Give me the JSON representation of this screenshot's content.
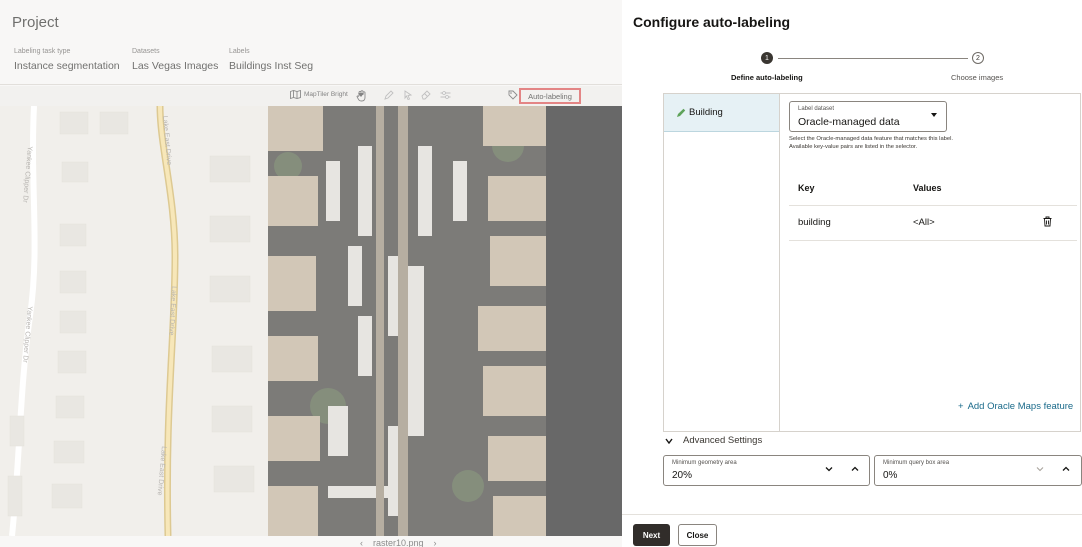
{
  "project": {
    "title": "Project",
    "info": [
      {
        "label": "Labeling task type",
        "value": "Instance segmentation"
      },
      {
        "label": "Datasets",
        "value": "Las Vegas Images"
      },
      {
        "label": "Labels",
        "value": "Buildings Inst Seg"
      }
    ],
    "toolbar": {
      "basemap_label": "MapTiler Bright",
      "autolabel_label": "Auto-labeling"
    },
    "map_streets": [
      "Yankee Clipper Dr",
      "Yankee Clipper Dr",
      "Lake East Drive",
      "Lake East Drive",
      "Lake East Drive"
    ],
    "file_nav": {
      "prev": "‹",
      "file": "raster10.png",
      "next": "›"
    }
  },
  "panel": {
    "title": "Configure auto-labeling",
    "steps": [
      {
        "number": "1",
        "label": "Define auto-labeling"
      },
      {
        "number": "2",
        "label": "Choose images"
      }
    ],
    "label_item": "Building",
    "dataset_select": {
      "label": "Label dataset",
      "value": "Oracle-managed data",
      "help": "Select the Oracle-managed data feature that matches this label. Available key-value pairs are listed in the selector."
    },
    "kv_table": {
      "headers": {
        "key": "Key",
        "values": "Values"
      },
      "rows": [
        {
          "key": "building",
          "value": "<All>"
        }
      ]
    },
    "add_feature": "Add Oracle Maps feature",
    "advanced_label": "Advanced Settings",
    "min_geometry": {
      "label": "Minimum geometry area",
      "value": "20%"
    },
    "min_box": {
      "label": "Minimum query box area",
      "value": "0%"
    },
    "buttons": {
      "next": "Next",
      "close": "Close"
    }
  }
}
